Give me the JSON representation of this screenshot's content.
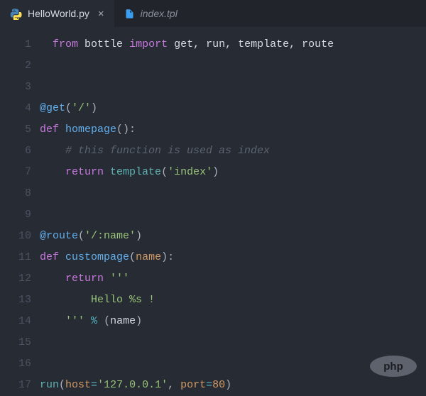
{
  "tabs": [
    {
      "label": "HelloWorld.py",
      "icon": "python-file-icon",
      "active": true,
      "closeable": true
    },
    {
      "label": "index.tpl",
      "icon": "file-icon",
      "active": false,
      "closeable": false
    }
  ],
  "watermark": "php",
  "code": {
    "lines": [
      {
        "n": "1",
        "indent": "  ",
        "tokens": [
          {
            "cls": "kw-import",
            "t": "from"
          },
          {
            "cls": "",
            "t": " "
          },
          {
            "cls": "mod",
            "t": "bottle"
          },
          {
            "cls": "",
            "t": " "
          },
          {
            "cls": "kw-import",
            "t": "import"
          },
          {
            "cls": "",
            "t": " "
          },
          {
            "cls": "names",
            "t": "get, run, template, route"
          }
        ]
      },
      {
        "n": "2",
        "indent": "",
        "tokens": []
      },
      {
        "n": "3",
        "indent": "",
        "tokens": []
      },
      {
        "n": "4",
        "indent": "",
        "tokens": [
          {
            "cls": "decor-at",
            "t": "@get"
          },
          {
            "cls": "punct",
            "t": "("
          },
          {
            "cls": "str",
            "t": "'/'"
          },
          {
            "cls": "punct",
            "t": ")"
          }
        ]
      },
      {
        "n": "5",
        "indent": "",
        "tokens": [
          {
            "cls": "kw-def",
            "t": "def"
          },
          {
            "cls": "",
            "t": " "
          },
          {
            "cls": "func",
            "t": "homepage"
          },
          {
            "cls": "punct",
            "t": "():"
          }
        ]
      },
      {
        "n": "6",
        "indent": "    ",
        "tokens": [
          {
            "cls": "comment",
            "t": "# this function is used as index"
          }
        ]
      },
      {
        "n": "7",
        "indent": "    ",
        "tokens": [
          {
            "cls": "kw-return",
            "t": "return"
          },
          {
            "cls": "",
            "t": " "
          },
          {
            "cls": "call",
            "t": "template"
          },
          {
            "cls": "punct",
            "t": "("
          },
          {
            "cls": "str",
            "t": "'index'"
          },
          {
            "cls": "punct",
            "t": ")"
          }
        ]
      },
      {
        "n": "8",
        "indent": "",
        "tokens": []
      },
      {
        "n": "9",
        "indent": "",
        "tokens": []
      },
      {
        "n": "10",
        "indent": "",
        "tokens": [
          {
            "cls": "decor-at",
            "t": "@route"
          },
          {
            "cls": "punct",
            "t": "("
          },
          {
            "cls": "str",
            "t": "'/:name'"
          },
          {
            "cls": "punct",
            "t": ")"
          }
        ]
      },
      {
        "n": "11",
        "indent": "",
        "tokens": [
          {
            "cls": "kw-def",
            "t": "def"
          },
          {
            "cls": "",
            "t": " "
          },
          {
            "cls": "func",
            "t": "custompage"
          },
          {
            "cls": "punct",
            "t": "("
          },
          {
            "cls": "param",
            "t": "name"
          },
          {
            "cls": "punct",
            "t": "):"
          }
        ]
      },
      {
        "n": "12",
        "indent": "    ",
        "tokens": [
          {
            "cls": "kw-return",
            "t": "return"
          },
          {
            "cls": "",
            "t": " "
          },
          {
            "cls": "str",
            "t": "'''"
          }
        ]
      },
      {
        "n": "13",
        "indent": "        ",
        "tokens": [
          {
            "cls": "str",
            "t": "Hello %s !"
          }
        ]
      },
      {
        "n": "14",
        "indent": "    ",
        "tokens": [
          {
            "cls": "str",
            "t": "'''"
          },
          {
            "cls": "",
            "t": " "
          },
          {
            "cls": "op",
            "t": "%"
          },
          {
            "cls": "",
            "t": " "
          },
          {
            "cls": "punct",
            "t": "("
          },
          {
            "cls": "names",
            "t": "name"
          },
          {
            "cls": "punct",
            "t": ")"
          }
        ]
      },
      {
        "n": "15",
        "indent": "",
        "tokens": []
      },
      {
        "n": "16",
        "indent": "",
        "tokens": []
      },
      {
        "n": "17",
        "indent": "",
        "tokens": [
          {
            "cls": "call",
            "t": "run"
          },
          {
            "cls": "punct",
            "t": "("
          },
          {
            "cls": "param",
            "t": "host"
          },
          {
            "cls": "op",
            "t": "="
          },
          {
            "cls": "str",
            "t": "'127.0.0.1'"
          },
          {
            "cls": "punct",
            "t": ", "
          },
          {
            "cls": "param",
            "t": "port"
          },
          {
            "cls": "op",
            "t": "="
          },
          {
            "cls": "num",
            "t": "80"
          },
          {
            "cls": "punct",
            "t": ")"
          }
        ]
      }
    ]
  }
}
